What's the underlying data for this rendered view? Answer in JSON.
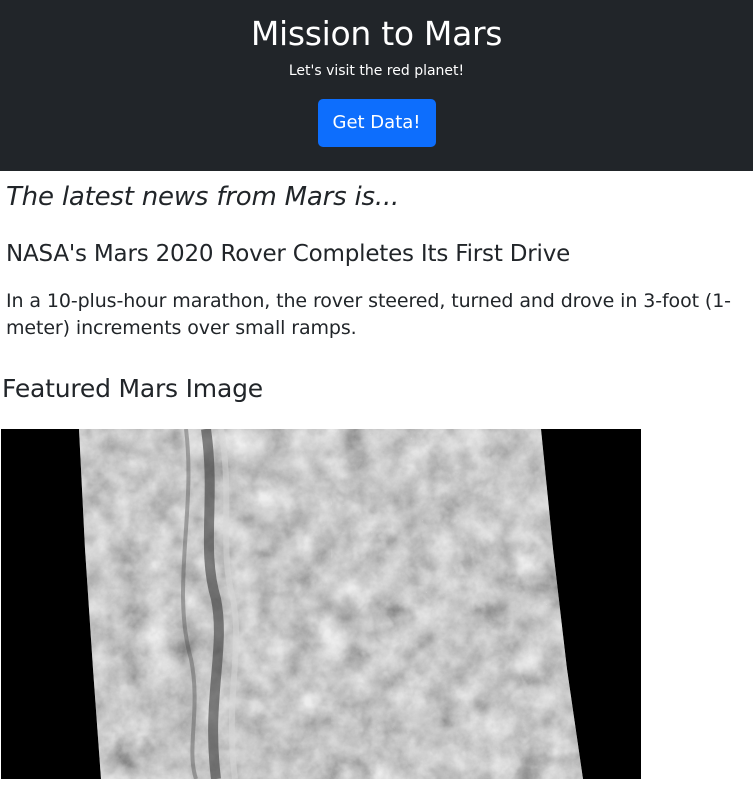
{
  "header": {
    "title": "Mission to Mars",
    "subtitle": "Let's visit the red planet!",
    "button_label": "Get Data!"
  },
  "news": {
    "heading": "The latest news from Mars is...",
    "title": "NASA's Mars 2020 Rover Completes Its First Drive",
    "paragraph": "In a 10-plus-hour marathon, the rover steered, turned and drove in 3-foot (1-meter) increments over small ramps."
  },
  "featured": {
    "heading": "Featured Mars Image"
  },
  "colors": {
    "header_bg": "#212529",
    "button_bg": "#0d6efd"
  }
}
